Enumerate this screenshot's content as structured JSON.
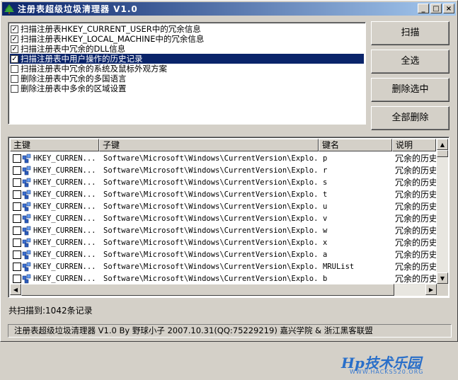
{
  "window": {
    "title": "注册表超级垃圾清理器  V1.0",
    "min_glyph": "_",
    "max_glyph": "□",
    "close_glyph": "×"
  },
  "options": [
    {
      "label": "扫描注册表HKEY_CURRENT_USER中的冗余信息",
      "checked": true,
      "selected": false
    },
    {
      "label": "扫描注册表HKEY_LOCAL_MACHINE中的冗余信息",
      "checked": true,
      "selected": false
    },
    {
      "label": "扫描注册表中冗余的DLL信息",
      "checked": true,
      "selected": false
    },
    {
      "label": "扫描注册表中用户操作的历史记录",
      "checked": true,
      "selected": true
    },
    {
      "label": "扫描注册表中冗余的系统及鼠标外观方案",
      "checked": false,
      "selected": false
    },
    {
      "label": "删除注册表中冗余的多国语言",
      "checked": false,
      "selected": false
    },
    {
      "label": "删除注册表中多余的区域设置",
      "checked": false,
      "selected": false
    }
  ],
  "buttons": {
    "scan": "扫描",
    "select_all": "全选",
    "delete_selected": "删除选中",
    "delete_all": "全部删除"
  },
  "table": {
    "columns": [
      "主键",
      "子键",
      "键名",
      "说明"
    ],
    "rows": [
      {
        "main": "HKEY_CURREN...",
        "sub": "Software\\Microsoft\\Windows\\CurrentVersion\\Explo...",
        "key": "p",
        "desc": "冗余的历史"
      },
      {
        "main": "HKEY_CURREN...",
        "sub": "Software\\Microsoft\\Windows\\CurrentVersion\\Explo...",
        "key": "r",
        "desc": "冗余的历史"
      },
      {
        "main": "HKEY_CURREN...",
        "sub": "Software\\Microsoft\\Windows\\CurrentVersion\\Explo...",
        "key": "s",
        "desc": "冗余的历史"
      },
      {
        "main": "HKEY_CURREN...",
        "sub": "Software\\Microsoft\\Windows\\CurrentVersion\\Explo...",
        "key": "t",
        "desc": "冗余的历史"
      },
      {
        "main": "HKEY_CURREN...",
        "sub": "Software\\Microsoft\\Windows\\CurrentVersion\\Explo...",
        "key": "u",
        "desc": "冗余的历史"
      },
      {
        "main": "HKEY_CURREN...",
        "sub": "Software\\Microsoft\\Windows\\CurrentVersion\\Explo...",
        "key": "v",
        "desc": "冗余的历史"
      },
      {
        "main": "HKEY_CURREN...",
        "sub": "Software\\Microsoft\\Windows\\CurrentVersion\\Explo...",
        "key": "w",
        "desc": "冗余的历史"
      },
      {
        "main": "HKEY_CURREN...",
        "sub": "Software\\Microsoft\\Windows\\CurrentVersion\\Explo...",
        "key": "x",
        "desc": "冗余的历史"
      },
      {
        "main": "HKEY_CURREN...",
        "sub": "Software\\Microsoft\\Windows\\CurrentVersion\\Explo...",
        "key": "a",
        "desc": "冗余的历史"
      },
      {
        "main": "HKEY_CURREN...",
        "sub": "Software\\Microsoft\\Windows\\CurrentVersion\\Explo...",
        "key": "MRUList",
        "desc": "冗余的历史"
      },
      {
        "main": "HKEY_CURREN...",
        "sub": "Software\\Microsoft\\Windows\\CurrentVersion\\Explo...",
        "key": "b",
        "desc": "冗余的历史"
      }
    ]
  },
  "watermark": {
    "main": "Hp技术乐园",
    "sub": "WWW.HACKS520.ORG"
  },
  "count_label": "共扫描到:1042条记录",
  "statusbar": "注册表超级垃圾清理器 V1.0   By 野球小子 2007.10.31(QQ:75229219)   嘉兴学院 & 浙江黑客联盟",
  "colors": {
    "title_start": "#0a246a",
    "title_end": "#a6caf0",
    "selection": "#0a246a",
    "face": "#d4d0c8"
  }
}
